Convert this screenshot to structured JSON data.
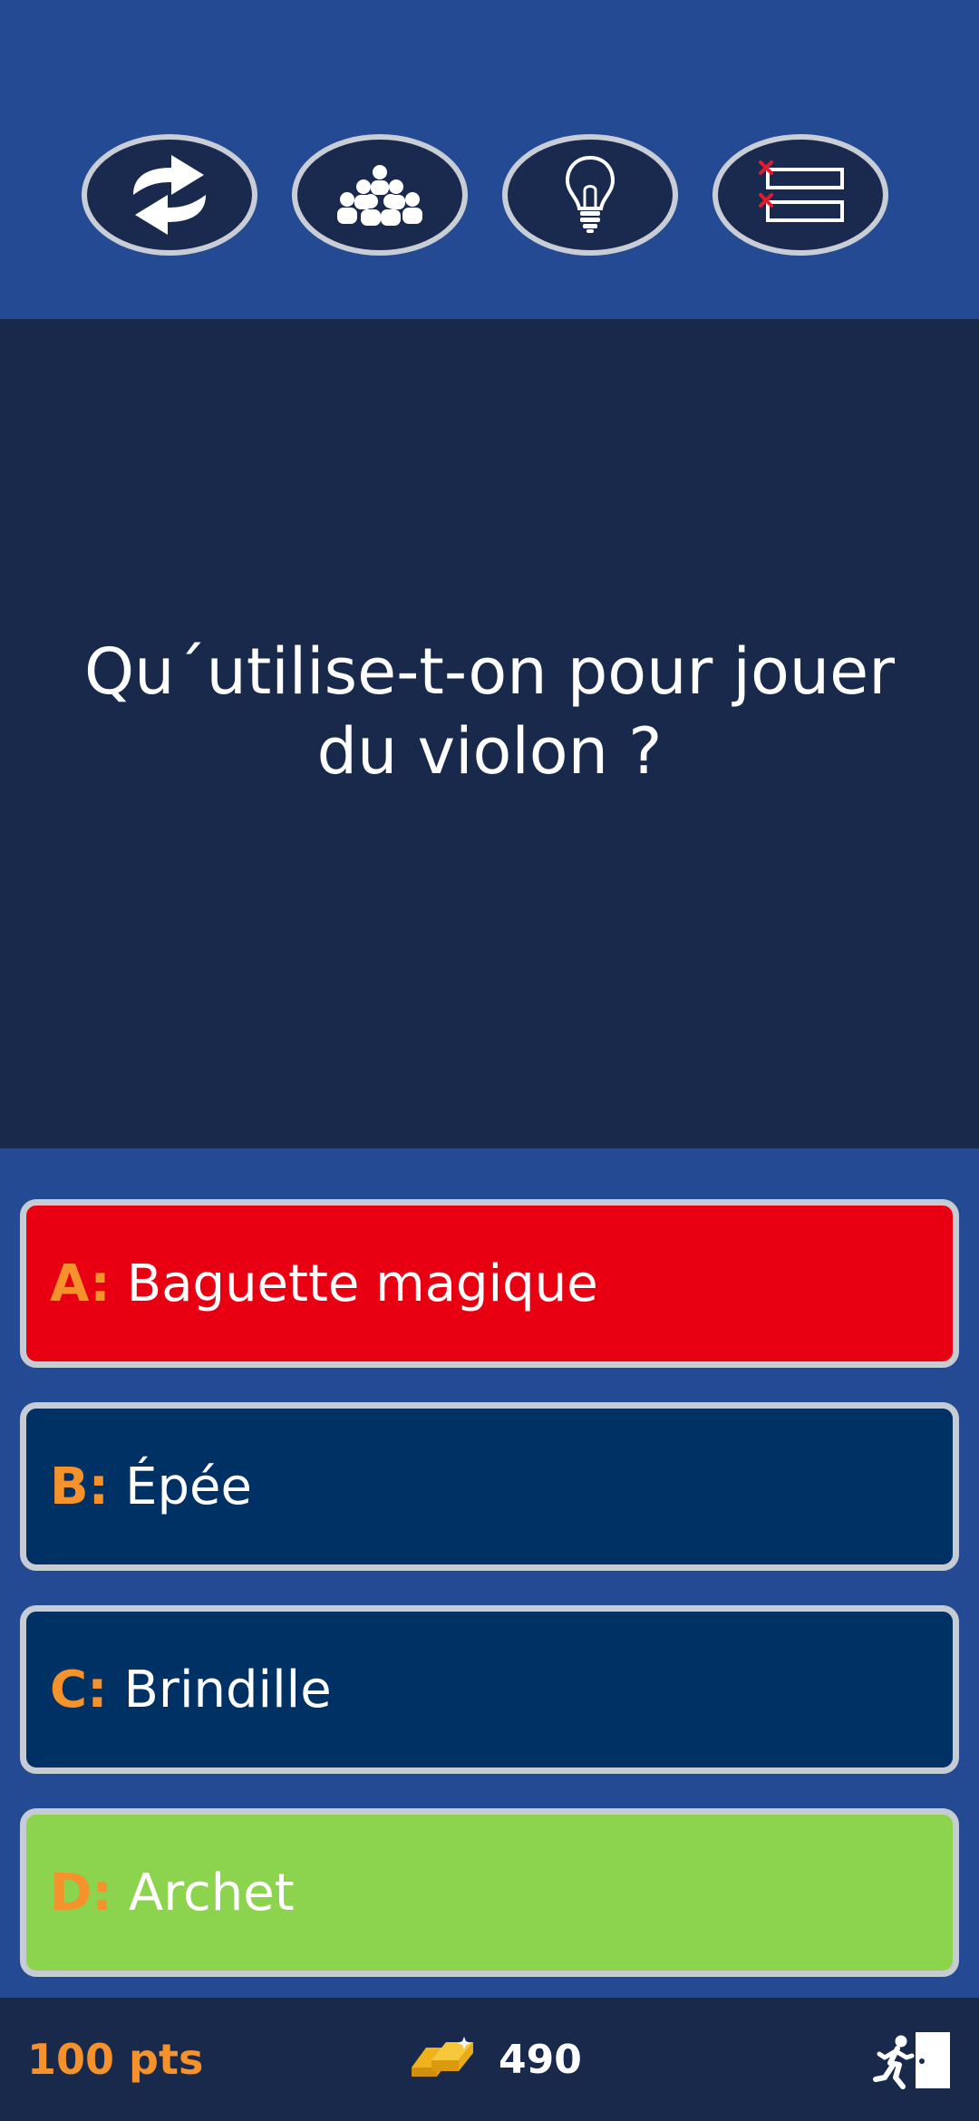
{
  "lifelines": [
    {
      "id": "switch",
      "icon": "swap-arrows-icon"
    },
    {
      "id": "audience",
      "icon": "audience-icon"
    },
    {
      "id": "hint",
      "icon": "lightbulb-icon"
    },
    {
      "id": "fifty",
      "icon": "fifty-fifty-icon"
    }
  ],
  "question": {
    "text": "Qu´utilise-t-on pour jouer du violon ?"
  },
  "answers": [
    {
      "letter": "A:",
      "text": "Baguette magique",
      "state": "wrong",
      "color": "#e80012"
    },
    {
      "letter": "B:",
      "text": "Épée",
      "state": "neutral",
      "color": "#003165"
    },
    {
      "letter": "C:",
      "text": "Brindille",
      "state": "neutral",
      "color": "#003165"
    },
    {
      "letter": "D:",
      "text": "Archet",
      "state": "correct",
      "color": "#8cd34e"
    }
  ],
  "footer": {
    "points": "100 pts",
    "gold_count": "490",
    "gold_icon": "gold-bars-icon",
    "exit_icon": "exit-door-icon"
  },
  "colors": {
    "background": "#234a92",
    "question_panel": "#19294b",
    "accent_letter": "#f5922b"
  }
}
